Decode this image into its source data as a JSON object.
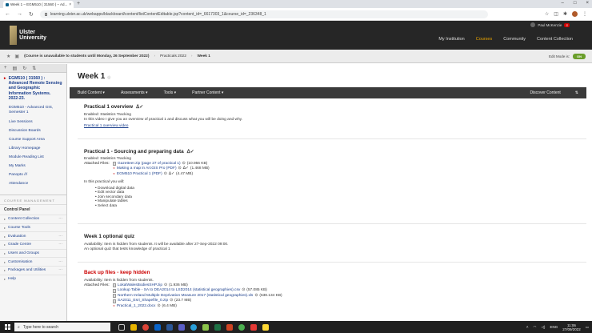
{
  "browser": {
    "tab_title": "Week 1 – EGM510 ( 31560 ) – Ad...",
    "url": "learning.ulster.ac.uk/webapps/blackboard/content/listContentEditable.jsp?content_id=_6617303_1&course_id=_236348_1",
    "profile_avatar": "P"
  },
  "header": {
    "logo_line1": "Ulster",
    "logo_line2": "University",
    "user_name": "Paul McKenzie",
    "nav": [
      "My Institution",
      "Courses",
      "Community",
      "Content Collection"
    ],
    "active_nav": "Courses"
  },
  "crumbs": {
    "course": "(Course is unavailable to students until Monday, 26 September 2022)",
    "items": [
      "Practicals 2022",
      "Week 1"
    ],
    "edit_mode_label": "Edit Mode is:",
    "edit_mode_state": "ON"
  },
  "sidebar": {
    "course_title": "EGM510 ( 31560 ) : Advanced Remote Sensing and Geographic Information Systems. 2022-23.",
    "links": [
      "EGM510 - Advanced GIS, Semester 1",
      "Live Sessions",
      "Discussion Boards",
      "Course Support Area",
      "Library Homepage",
      "Module Reading List",
      "My Marks",
      "Panopto ///",
      "Attendance"
    ],
    "cm_heading": "COURSE MANAGEMENT",
    "cp_heading": "Control Panel",
    "cp_items": [
      "Content Collection",
      "Course Tools",
      "Evaluation",
      "Grade Centre",
      "Users and Groups",
      "Customisation",
      "Packages and Utilities",
      "Help"
    ]
  },
  "main": {
    "page_title": "Week 1",
    "actions": [
      "Build Content",
      "Assessments",
      "Tools",
      "Partner Content"
    ],
    "action_right": "Discover Content",
    "items": [
      {
        "title": "Practical 1 overview",
        "enabled": "Enabled:  Statistics Tracking",
        "desc": "In this video I give you an overview of practical 1 and discuss what you will be doing and why.",
        "link": "Practical 1 overview video"
      },
      {
        "title": "Practical 1 - Sourcing and preparing data",
        "enabled": "Enabled:  Statistics Tracking",
        "files_label": "Attached Files:",
        "files": [
          {
            "name": "Gazetteer.zip (page 27 of practical 1)",
            "size": "(10.956 KB)"
          },
          {
            "name": "Making a map in ArcGIS Pro (PDF)",
            "size": "(1.468 MB)"
          },
          {
            "name": "EGM510 Practical 1 (PDF)",
            "size": "(4.47 MB)"
          }
        ],
        "intro": "In this practical you will:",
        "bullets": [
          "Download digital data",
          "Edit vector data",
          "Join secondary data",
          "Manipulate tables",
          "Select data"
        ]
      },
      {
        "title": "Week 1 optional quiz",
        "availability": "Availability:  Item is hidden from students. It will be available after 27-Sep-2022 09:00.",
        "desc": "An optional quiz that tests knowledge of practical 1"
      },
      {
        "title": "Back up files - keep hidden",
        "availability": "Availability:  Item is hidden from students.",
        "files_label": "Attached Files:",
        "files": [
          {
            "name": "LokalWalesBodiesSHP.zip",
            "size": "(1.936 MB)"
          },
          {
            "name": "Lookup Table - SA to DEA2014 to LSD2014 (statistical geographies).csv",
            "size": "(57.085 KB)"
          },
          {
            "name": "Northern Ireland Multiple Deprivation Measure 2017 (statistical geographies).xls",
            "size": "(638.134 KB)"
          },
          {
            "name": "SA2011_Esri_Shapefile_0.zip",
            "size": "(23.7 MB)"
          },
          {
            "name": "Practical_1_2022.docx",
            "size": "(6.4 MB)"
          }
        ]
      }
    ]
  },
  "taskbar": {
    "search_placeholder": "Type here to search",
    "time": "11:06",
    "date": "27/09/2022",
    "lang": "ENG"
  }
}
